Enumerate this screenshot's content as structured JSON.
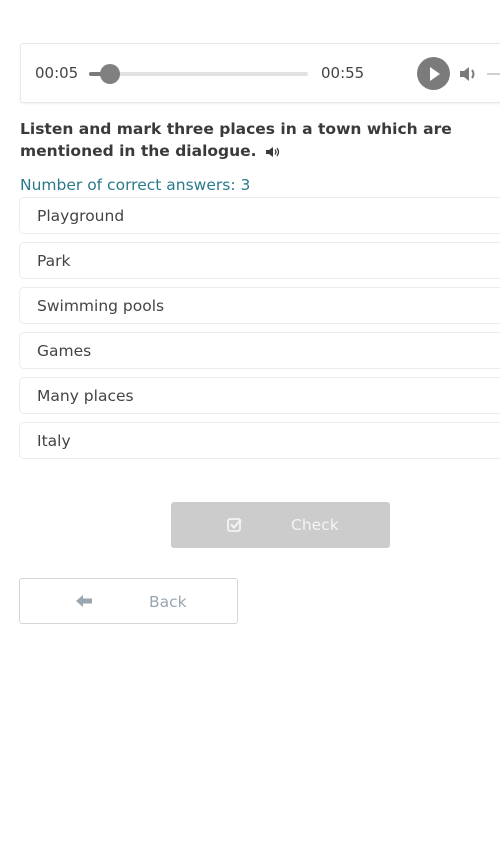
{
  "audio_player": {
    "current_time": "00:05",
    "duration": "00:55",
    "progress_fraction": 0.096,
    "play_icon": "play-icon",
    "volume_icon": "speaker-icon"
  },
  "question": {
    "text": "Listen and mark three places in a town which are mentioned in the dialogue.",
    "sound_icon": "speaker-icon",
    "hint": "Number of correct answers: 3"
  },
  "options": [
    {
      "label": "Playground"
    },
    {
      "label": "Park"
    },
    {
      "label": "Swimming pools"
    },
    {
      "label": "Games"
    },
    {
      "label": "Many places"
    },
    {
      "label": "Italy"
    }
  ],
  "buttons": {
    "check_label": "Check",
    "check_icon": "checkbox-icon",
    "back_label": "Back",
    "back_icon": "arrow-left-icon"
  },
  "colors": {
    "hint": "#2a7a8c",
    "check_disabled_bg": "#cccccc",
    "player_controls": "#7b7b7b"
  }
}
